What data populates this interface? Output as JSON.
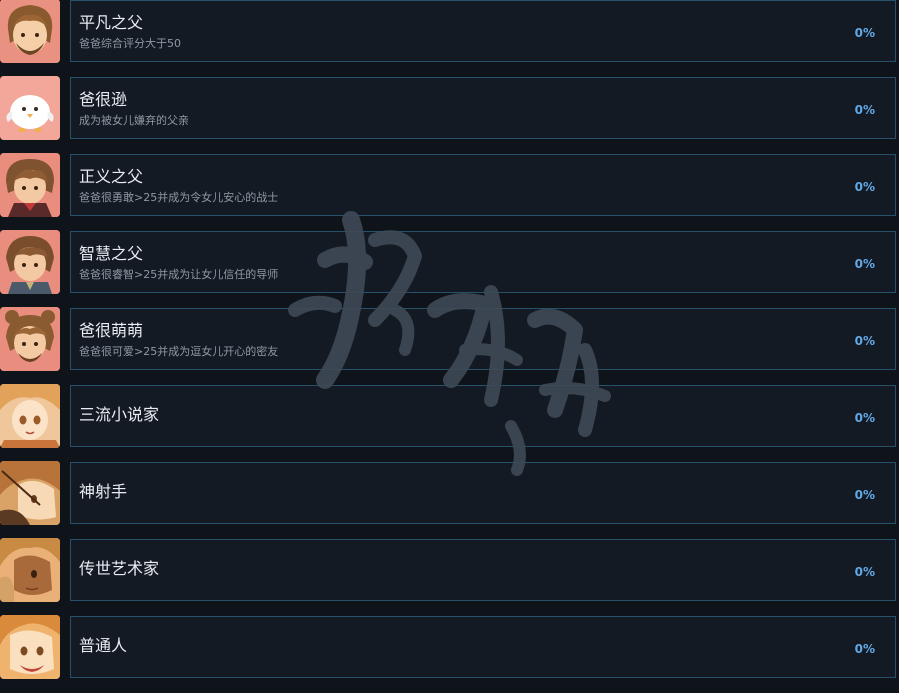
{
  "achievements": [
    {
      "title": "平凡之父",
      "description": "爸爸综合评分大于50",
      "percent": "0%",
      "icon": "bearded-father-portrait"
    },
    {
      "title": "爸很逊",
      "description": "成为被女儿嫌弃的父亲",
      "percent": "0%",
      "icon": "white-chick-portrait"
    },
    {
      "title": "正义之父",
      "description": "爸爸很勇敢>25并成为令女儿安心的战士",
      "percent": "0%",
      "icon": "father-warrior-portrait"
    },
    {
      "title": "智慧之父",
      "description": "爸爸很睿智>25并成为让女儿信任的导师",
      "percent": "0%",
      "icon": "father-mentor-portrait"
    },
    {
      "title": "爸很萌萌",
      "description": "爸爸很可爱>25并成为逗女儿开心的密友",
      "percent": "0%",
      "icon": "father-bear-ears-portrait"
    },
    {
      "title": "三流小说家",
      "description": "",
      "percent": "0%",
      "icon": "daughter-novelist-portrait"
    },
    {
      "title": "神射手",
      "description": "",
      "percent": "0%",
      "icon": "daughter-archer-portrait"
    },
    {
      "title": "传世艺术家",
      "description": "",
      "percent": "0%",
      "icon": "daughter-artist-portrait"
    },
    {
      "title": "普通人",
      "description": "",
      "percent": "0%",
      "icon": "daughter-ordinary-portrait"
    }
  ],
  "colors": {
    "background": "#0f141b",
    "card": "#131a23",
    "card_border": "#27506a",
    "percent": "#62a8e6",
    "avatar_frame": "#e88f80"
  },
  "watermark": {
    "text": "游侠网",
    "icon": "watermark-logo"
  }
}
